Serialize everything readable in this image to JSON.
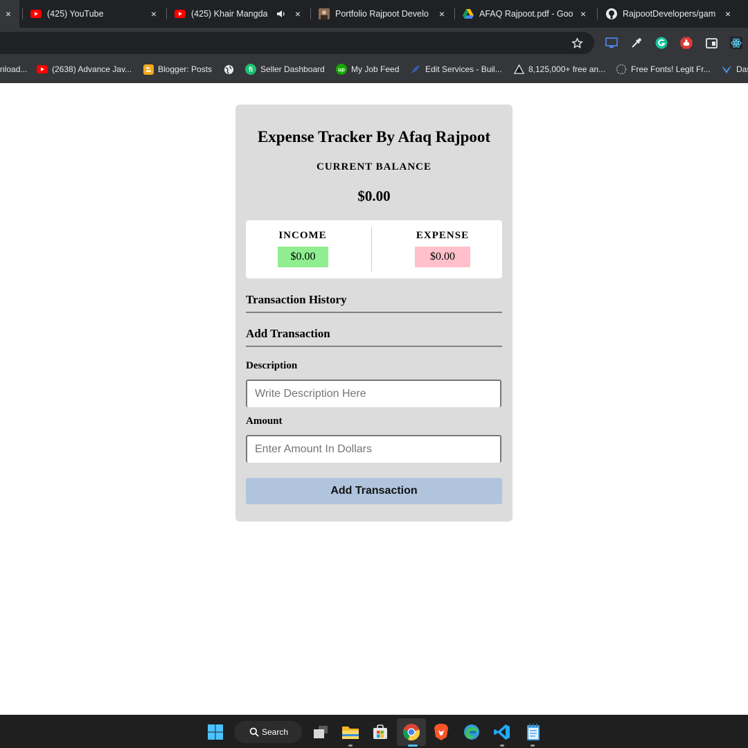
{
  "browser": {
    "tabs": [
      {
        "title": "(425) YouTube",
        "favicon": "youtube-icon"
      },
      {
        "title": "(425) Khair Mangda |",
        "favicon": "youtube-icon",
        "audio": "speaker-icon"
      },
      {
        "title": "Portfolio Rajpoot Develo",
        "favicon": "portrait-icon"
      },
      {
        "title": "AFAQ Rajpoot.pdf - Goo",
        "favicon": "google-drive-icon"
      },
      {
        "title": "RajpootDevelopers/gam",
        "favicon": "github-icon"
      }
    ],
    "close_glyph": "×",
    "bookmarks": [
      {
        "label": "nload...",
        "favicon": "none"
      },
      {
        "label": "(2638) Advance Jav...",
        "favicon": "youtube-icon"
      },
      {
        "label": "Blogger: Posts",
        "favicon": "blogger-icon"
      },
      {
        "label": "",
        "favicon": "globe-icon"
      },
      {
        "label": "Seller Dashboard",
        "favicon": "fiverr-icon"
      },
      {
        "label": "My Job Feed",
        "favicon": "upwork-icon"
      },
      {
        "label": "Edit Services - Buil...",
        "favicon": "feather-icon"
      },
      {
        "label": "8,125,000+ free an...",
        "favicon": "freepik-icon"
      },
      {
        "label": "Free Fonts! Legit Fr...",
        "favicon": "fontspace-icon"
      },
      {
        "label": "Das",
        "favicon": "bird-icon"
      }
    ]
  },
  "app": {
    "title": "Expense Tracker By Afaq Rajpoot",
    "balance_label": "CURRENT BALANCE",
    "balance_value": "$0.00",
    "income_label": "INCOME",
    "income_value": "$0.00",
    "expense_label": "EXPENSE",
    "expense_value": "$0.00",
    "history_heading": "Transaction History",
    "add_heading": "Add Transaction",
    "description_label": "Description",
    "description_placeholder": "Write Description Here",
    "amount_label": "Amount",
    "amount_placeholder": "Enter Amount In Dollars",
    "submit_label": "Add Transaction"
  },
  "taskbar": {
    "search_label": "Search",
    "apps": [
      "windows-start-icon",
      "task-view-icon",
      "file-explorer-icon",
      "microsoft-store-icon",
      "chrome-icon",
      "brave-icon",
      "edge-icon",
      "vscode-icon",
      "notepad-icon"
    ]
  },
  "colors": {
    "income_bg": "#90ee90",
    "expense_bg": "#ffc0cb",
    "button_bg": "#b0c4de",
    "card_bg": "#dcdcdc"
  }
}
